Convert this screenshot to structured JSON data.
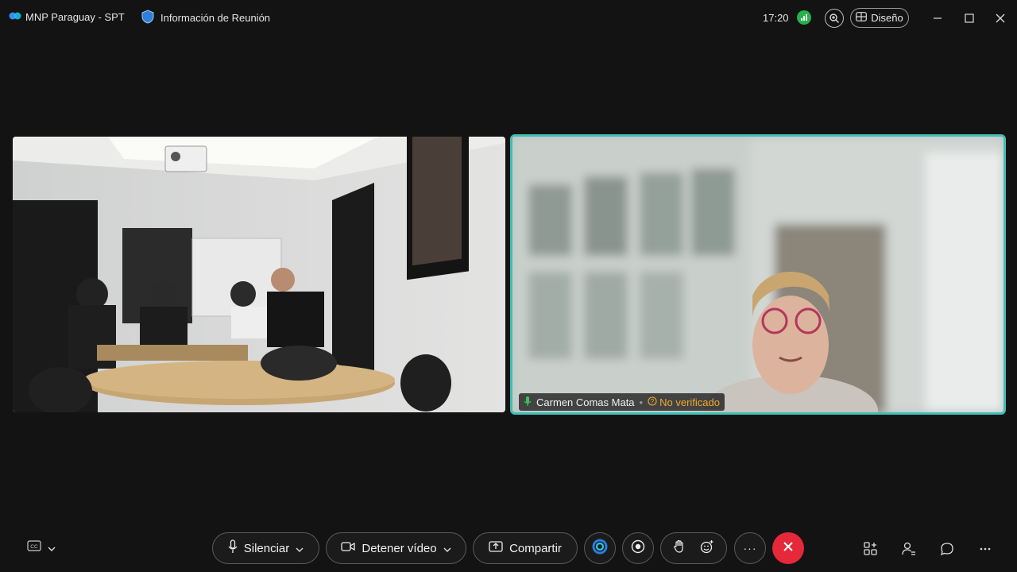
{
  "titlebar": {
    "app_name": "MNP Paraguay - SPT",
    "meeting_info": "Información de Reunión",
    "time": "17:20",
    "layout_label": "Diseño"
  },
  "participants": [
    {
      "type": "room"
    },
    {
      "name": "Carmen Comas Mata",
      "status": "No verificado"
    }
  ],
  "toolbar": {
    "mute_label": "Silenciar",
    "video_label": "Detener vídeo",
    "share_label": "Compartir",
    "more_label": "···"
  },
  "colors": {
    "background": "#131313",
    "active_speaker_border": "#3fbfb5",
    "end_call": "#e5283a",
    "unverified": "#f0a830",
    "network_ok": "#27b14b"
  }
}
